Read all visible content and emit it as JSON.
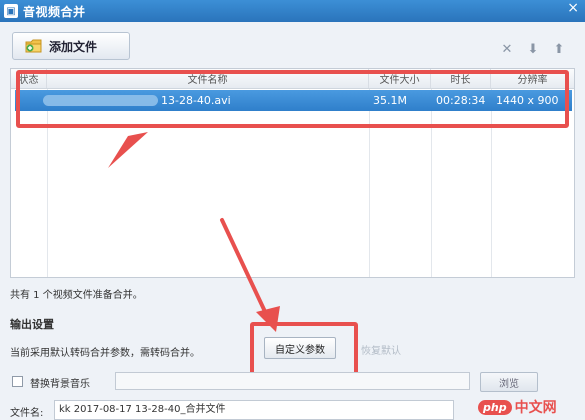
{
  "window": {
    "title": "音视频合并",
    "close_glyph": "×"
  },
  "toolbar": {
    "add_label": "添加文件",
    "icons": [
      "close-icon",
      "down-arrow-icon",
      "up-arrow-icon"
    ],
    "icon_glyphs": [
      "✕",
      "⬇",
      "⬆"
    ]
  },
  "list": {
    "columns": [
      "状态",
      "文件名称",
      "文件大小",
      "时长",
      "分辨率"
    ],
    "rows": [
      {
        "name": "13-28-40.avi",
        "size": "35.1M",
        "duration": "00:28:34",
        "resolution": "1440 x 900"
      }
    ]
  },
  "count_text": "共有 1 个视频文件准备合并。",
  "output": {
    "title": "输出设置",
    "desc": "当前采用默认转码合并参数，需转码合并。",
    "custom_button": "自定义参数",
    "restore_button": "恢复默认"
  },
  "bgm": {
    "label": "替换背景音乐",
    "browse": "浏览"
  },
  "filename": {
    "label": "文件名:",
    "value": "kk 2017-08-17 13-28-40_合并文件"
  },
  "watermark": {
    "badge": "php",
    "text": "中文网"
  },
  "colors": {
    "accent": "#2f7fcb",
    "highlight": "#e8504e"
  }
}
